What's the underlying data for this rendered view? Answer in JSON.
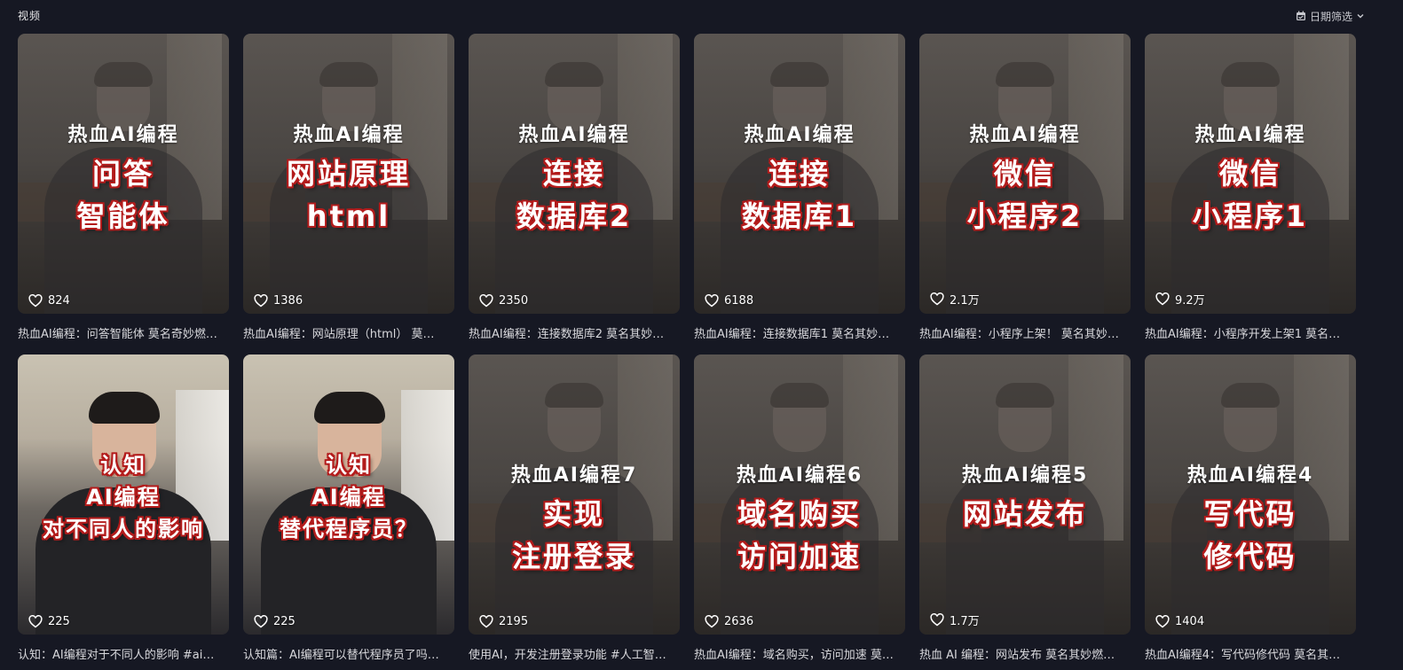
{
  "header": {
    "title": "视频",
    "filter_label": "日期筛选",
    "filter_icon": "calendar-icon",
    "chevron_icon": "chevron-down-icon"
  },
  "videos": [
    {
      "series": "热血AI编程",
      "topic_line1": "问答",
      "topic_line2": "智能体",
      "likes": "824",
      "caption": "热血AI编程：问答智能体 莫名奇妙燃…"
    },
    {
      "series": "热血AI编程",
      "topic_line1": "网站原理",
      "topic_line2": "html",
      "likes": "1386",
      "caption": "热血AI编程：网站原理（html） 莫…"
    },
    {
      "series": "热血AI编程",
      "topic_line1": "连接",
      "topic_line2": "数据库2",
      "likes": "2350",
      "caption": "热血AI编程：连接数据库2 莫名其妙…"
    },
    {
      "series": "热血AI编程",
      "topic_line1": "连接",
      "topic_line2": "数据库1",
      "likes": "6188",
      "caption": "热血AI编程：连接数据库1 莫名其妙…"
    },
    {
      "series": "热血AI编程",
      "topic_line1": "微信",
      "topic_line2": "小程序2",
      "likes": "2.1万",
      "caption": "热血AI编程：小程序上架！ 莫名其妙…"
    },
    {
      "series": "热血AI编程",
      "topic_line1": "微信",
      "topic_line2": "小程序1",
      "likes": "9.2万",
      "caption": "热血AI编程：小程序开发上架1 莫名…"
    },
    {
      "series": "认知",
      "topic_line1": "AI编程",
      "topic_line2": "对不同人的影响",
      "likes": "225",
      "caption": "认知：AI编程对于不同人的影响 #ai…"
    },
    {
      "series": "认知",
      "topic_line1": "AI编程",
      "topic_line2": "替代程序员？",
      "likes": "225",
      "caption": "认知篇：AI编程可以替代程序员了吗…"
    },
    {
      "series": "热血AI编程7",
      "topic_line1": "实现",
      "topic_line2": "注册登录",
      "likes": "2195",
      "caption": "使用AI，开发注册登录功能 #人工智…"
    },
    {
      "series": "热血AI编程6",
      "topic_line1": "域名购买",
      "topic_line2": "访问加速",
      "likes": "2636",
      "caption": "热血AI编程：域名购买，访问加速 莫…"
    },
    {
      "series": "热血AI编程5",
      "topic_line1": "网站发布",
      "topic_line2": "",
      "likes": "1.7万",
      "caption": "热血 AI 编程：网站发布 莫名其妙燃…"
    },
    {
      "series": "热血AI编程4",
      "topic_line1": "写代码",
      "topic_line2": "修代码",
      "likes": "1404",
      "caption": "热血AI编程4：写代码修代码 莫名其…"
    }
  ]
}
